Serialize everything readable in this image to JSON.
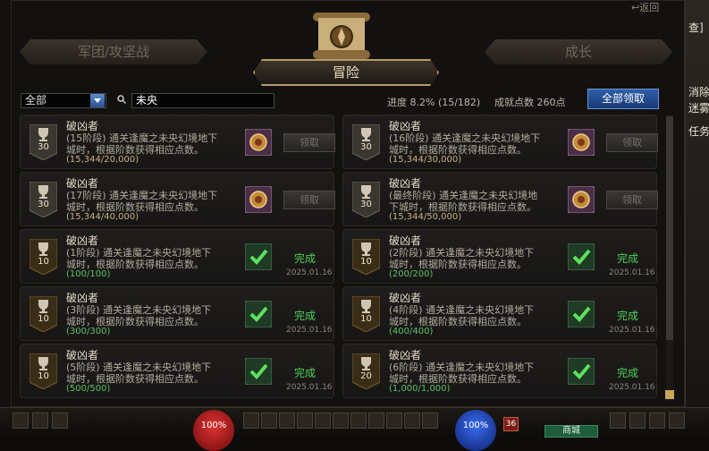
{
  "window": {
    "back_label": "返回",
    "tabs": {
      "left": "军团/攻坚战",
      "center": "冒险",
      "right": "成长"
    }
  },
  "filter": {
    "selected": "全部",
    "search_value": "未央"
  },
  "summary": {
    "progress": "进度  8.2% (15/182)",
    "points": "成就点数 260点",
    "claim_all": "全部领取"
  },
  "achievements": [
    {
      "points": "30",
      "title": "破凶者",
      "desc1": "(15阶段) 通关逢魔之未央幻境地下",
      "desc2": "城时，根据阶数获得相应点数。",
      "progress": "(15,344/20,000)",
      "status": "claim",
      "button": "领取"
    },
    {
      "points": "30",
      "title": "破凶者",
      "desc1": "(16阶段) 通关逢魔之未央幻境地下",
      "desc2": "城时，根据阶数获得相应点数。",
      "progress": "(15,344/30,000)",
      "status": "claim",
      "button": "领取"
    },
    {
      "points": "30",
      "title": "破凶者",
      "desc1": "(17阶段) 通关逢魔之未央幻境地下",
      "desc2": "城时，根据阶数获得相应点数。",
      "progress": "(15,344/40,000)",
      "status": "claim",
      "button": "领取"
    },
    {
      "points": "30",
      "title": "破凶者",
      "desc1": "(最终阶段) 通关逢魔之未央幻境地",
      "desc2": "下城时，根据阶数获得相应点数。",
      "progress": "(15,344/50,000)",
      "status": "claim",
      "button": "领取"
    },
    {
      "points": "10",
      "title": "破凶者",
      "desc1": "(1阶段) 通关逢魔之未央幻境地下",
      "desc2": "城时，根据阶数获得相应点数。",
      "progress": "(100/100)",
      "status": "done",
      "done_label": "完成",
      "date": "2025.01.16"
    },
    {
      "points": "10",
      "title": "破凶者",
      "desc1": "(2阶段) 通关逢魔之未央幻境地下",
      "desc2": "城时，根据阶数获得相应点数。",
      "progress": "(200/200)",
      "status": "done",
      "done_label": "完成",
      "date": "2025.01.16"
    },
    {
      "points": "10",
      "title": "破凶者",
      "desc1": "(3阶段) 通关逢魔之未央幻境地下",
      "desc2": "城时，根据阶数获得相应点数。",
      "progress": "(300/300)",
      "status": "done",
      "done_label": "完成",
      "date": "2025.01.16"
    },
    {
      "points": "10",
      "title": "破凶者",
      "desc1": "(4阶段) 通关逢魔之未央幻境地下",
      "desc2": "城时，根据阶数获得相应点数。",
      "progress": "(400/400)",
      "status": "done",
      "done_label": "完成",
      "date": "2025.01.16"
    },
    {
      "points": "10",
      "title": "破凶者",
      "desc1": "(5阶段) 通关逢魔之未央幻境地下",
      "desc2": "城时，根据阶数获得相应点数。",
      "progress": "(500/500)",
      "status": "done",
      "done_label": "完成",
      "date": "2025.01.16"
    },
    {
      "points": "20",
      "title": "破凶者",
      "desc1": "(6阶段) 通关逢魔之未央幻境地下",
      "desc2": "城时，根据阶数获得相应点数。",
      "progress": "(1,000/1,000)",
      "status": "done",
      "done_label": "完成",
      "date": "2025.01.16"
    }
  ],
  "right_strip": {
    "lines": [
      "查]",
      "消除",
      "迷雾",
      "任务"
    ]
  },
  "hud": {
    "hp": "100%",
    "mp": "100%",
    "level": "36",
    "shop": "商城"
  },
  "icons": {
    "trophy": "trophy-icon",
    "reward": "reward-emblem-icon",
    "done": "checkmark-icon",
    "emblem": "scroll-compass-icon"
  }
}
